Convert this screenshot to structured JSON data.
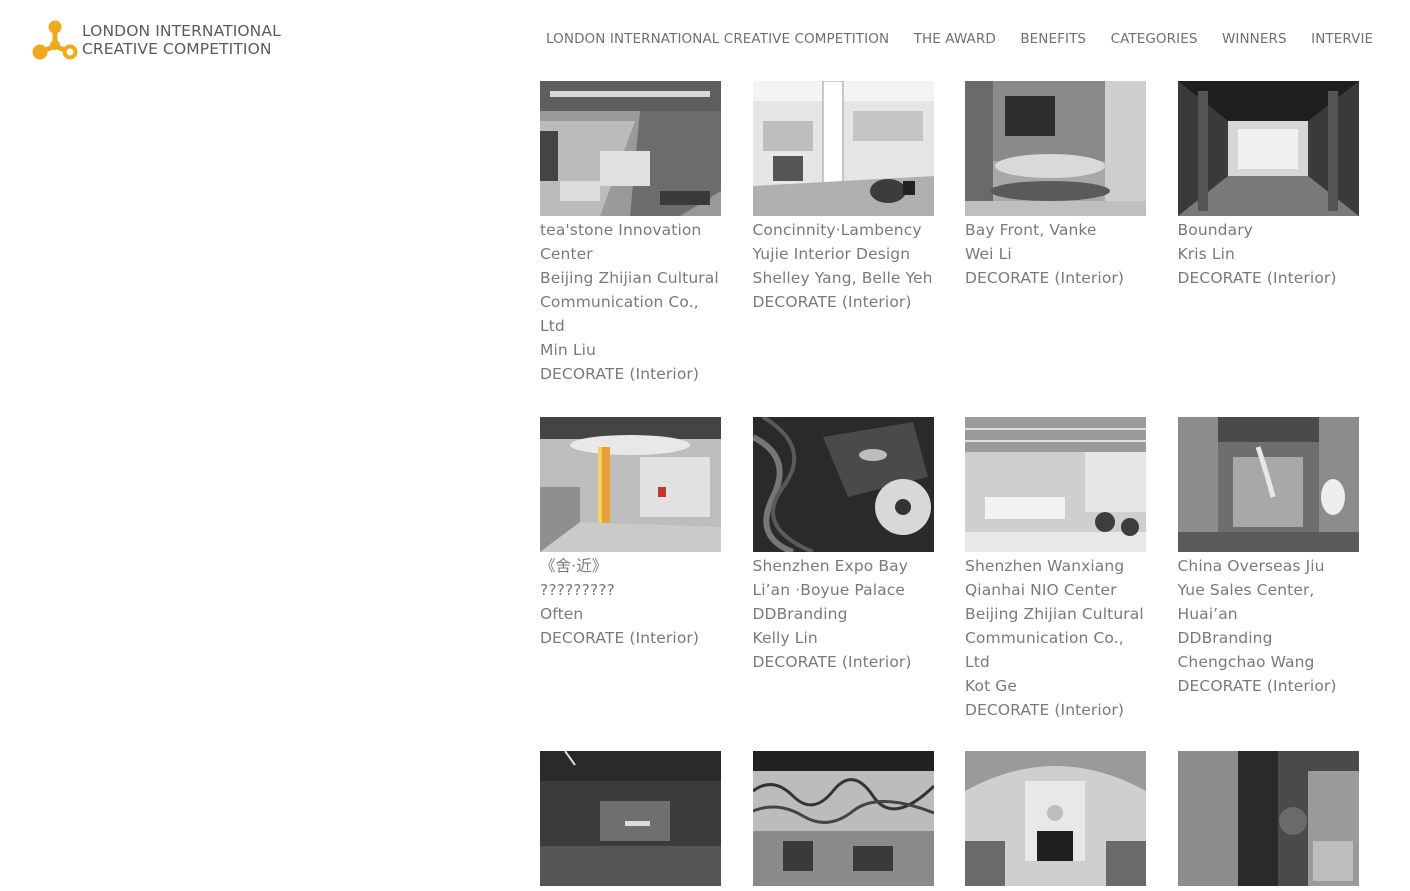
{
  "brand": {
    "line1": "LONDON INTERNATIONAL",
    "line2": "CREATIVE COMPETITION",
    "logo_icon": "molecule-logo-icon",
    "accent": "#f0a81e"
  },
  "nav": [
    "LONDON INTERNATIONAL CREATIVE COMPETITION",
    "THE AWARD",
    "BENEFITS",
    "CATEGORIES",
    "WINNERS",
    "INTERVIE"
  ],
  "rows": [
    [
      {
        "lines": [
          "tea'stone Innovation",
          "Center",
          "Beijing Zhijian Cultural",
          "Communication Co.,",
          "Ltd",
          "Min Liu"
        ],
        "category": "DECORATE (Interior)"
      },
      {
        "lines": [
          "Concinnity·Lambency",
          "Yujie Interior Design",
          "Shelley Yang, Belle Yeh"
        ],
        "category": "DECORATE (Interior)"
      },
      {
        "lines": [
          "Bay Front, Vanke",
          "Wei Li"
        ],
        "category": "DECORATE (Interior)"
      },
      {
        "lines": [
          "Boundary",
          "Kris Lin"
        ],
        "category": "DECORATE (Interior)"
      }
    ],
    [
      {
        "lines": [
          "《舍·近》",
          "?????????",
          "Often"
        ],
        "category": "DECORATE (Interior)"
      },
      {
        "lines": [
          "Shenzhen Expo Bay",
          "Li’an ·Boyue Palace",
          "DDBranding",
          "Kelly Lin"
        ],
        "category": "DECORATE (Interior)"
      },
      {
        "lines": [
          "Shenzhen Wanxiang",
          "Qianhai NIO Center",
          "Beijing Zhijian Cultural",
          "Communication Co.,",
          "Ltd",
          "Kot Ge"
        ],
        "category": "DECORATE (Interior)"
      },
      {
        "lines": [
          "China Overseas Jiu",
          "Yue Sales Center,",
          "Huai’an",
          "DDBranding",
          "Chengchao Wang"
        ],
        "category": "DECORATE (Interior)"
      }
    ],
    [
      {
        "lines": [],
        "category": ""
      },
      {
        "lines": [],
        "category": ""
      },
      {
        "lines": [],
        "category": ""
      },
      {
        "lines": [],
        "category": ""
      }
    ]
  ]
}
